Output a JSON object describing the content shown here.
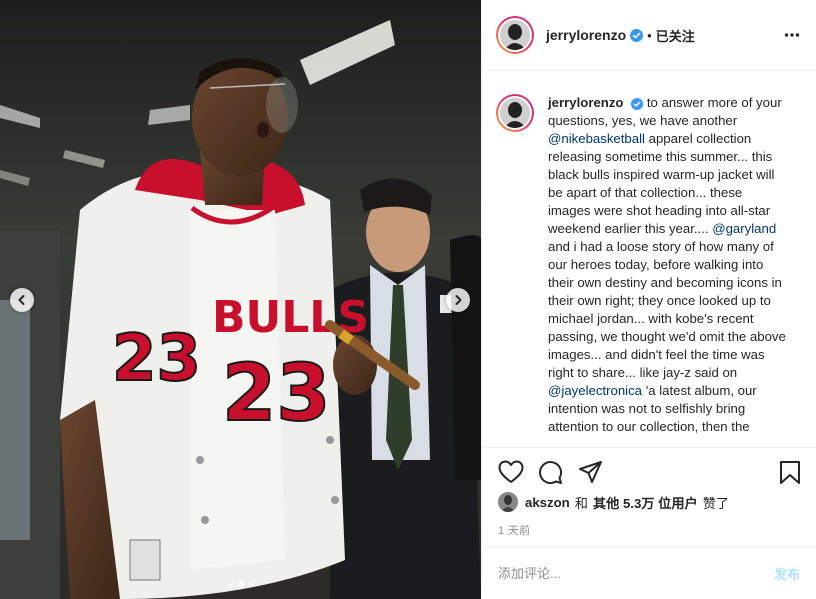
{
  "header": {
    "username": "jerrylorenzo",
    "separator": "•",
    "follow_status": "已关注"
  },
  "caption": {
    "username": "jerrylorenzo",
    "segments": [
      "to answer more of your questions, yes, we have another ",
      "@nikebasketball",
      " apparel collection releasing sometime this summer... this black bulls inspired warm-up jacket will be apart of that collection... these images were shot heading into all-star weekend earlier this year.... ",
      "@garyland",
      " and i had a loose story of how many of our heroes today, before walking into their own destiny and becoming icons in their own right; they once looked up to michael jordan... with kobe's recent passing, we thought we'd omit the above images... and didn't feel the time was right to share... like jay-z said on ",
      "@jayelectronica",
      " 'a latest album, our intention was not to selfishly bring attention to our collection, then the"
    ]
  },
  "media": {
    "jersey_text": "BULLS",
    "jersey_number": "23",
    "carousel_count": 3,
    "carousel_active": 1
  },
  "likes": {
    "user": "akszon",
    "and": "和",
    "others": "其他 5.3万 位用户",
    "liked": "赞了"
  },
  "timestamp": "1 天前",
  "comment": {
    "placeholder": "添加评论...",
    "post_label": "发布"
  },
  "colors": {
    "verified_blue": "#3897f0",
    "mention_blue": "#00376b",
    "post_disabled": "#b2dffc",
    "jersey_red": "#c8102e"
  }
}
